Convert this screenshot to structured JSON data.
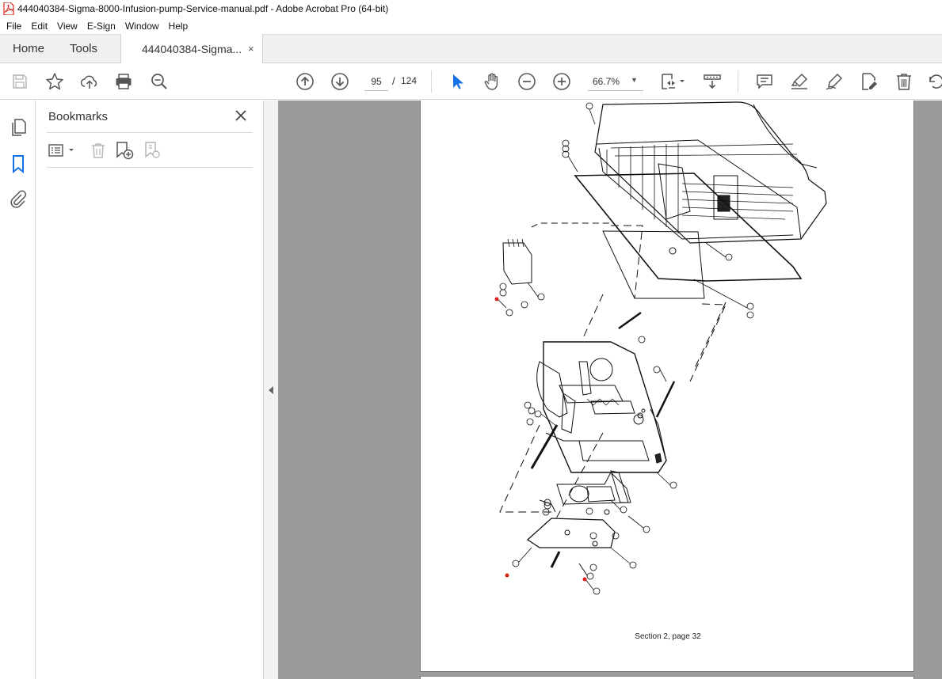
{
  "window": {
    "title": "444040384-Sigma-8000-Infusion-pump-Service-manual.pdf - Adobe Acrobat Pro (64-bit)"
  },
  "menu": {
    "items": [
      "File",
      "Edit",
      "View",
      "E-Sign",
      "Window",
      "Help"
    ]
  },
  "tabs": {
    "home": "Home",
    "tools": "Tools",
    "document": "444040384-Sigma...",
    "close": "×"
  },
  "toolbar": {
    "current_page": "95",
    "separator": "/",
    "total_pages": "124",
    "zoom": "66.7%",
    "icons": [
      "save-icon",
      "star-icon",
      "upload-cloud-icon",
      "print-icon",
      "search-zoom-icon",
      "page-up-icon",
      "page-down-icon",
      "select-cursor-icon",
      "hand-icon",
      "zoom-out-icon",
      "zoom-in-icon",
      "page-fit-icon",
      "scroll-mode-icon",
      "comment-icon",
      "highlight-icon",
      "sign-icon",
      "edit-pdf-icon",
      "delete-icon",
      "rotate-icon"
    ]
  },
  "bookmarks": {
    "title": "Bookmarks",
    "close": "×",
    "tools": [
      "options-menu-icon",
      "delete-bookmark-icon",
      "add-bookmark-icon",
      "bookmark-settings-icon"
    ]
  },
  "left_rail": {
    "icons": [
      "page-thumbnails-icon",
      "bookmarks-icon",
      "attachments-icon"
    ]
  },
  "document": {
    "footer": "Section 2, page 32"
  },
  "colors": {
    "accent_blue": "#1473e6",
    "doc_background": "#9b9b9b",
    "red_marker": "#e0201a"
  }
}
